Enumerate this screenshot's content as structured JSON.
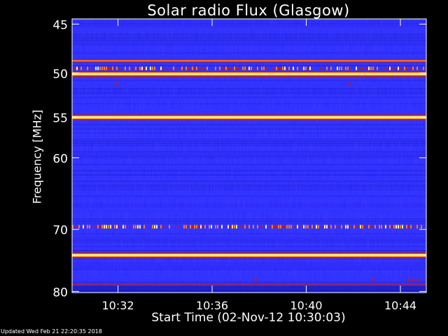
{
  "chart_data": {
    "type": "heatmap",
    "title": "Solar radio Flux (Glasgow)",
    "xlabel": "Start Time (02-Nov-12 10:30:03)",
    "ylabel": "Frequency [MHz]",
    "x_ticks": [
      "10:32",
      "10:36",
      "10:40",
      "10:44"
    ],
    "x_tick_minutes": [
      2,
      6,
      10,
      14
    ],
    "xlim_minutes": [
      0.05,
      15.1
    ],
    "y_ticks": [
      45,
      50,
      55,
      60,
      70,
      80
    ],
    "ylim": [
      44.5,
      80.2
    ],
    "colors": {
      "background_low": "#1a1ad8",
      "background_mid": "#2a2aff",
      "band_red": "#c01818",
      "band_orange": "#ff7a10",
      "band_yellow": "#fff38a"
    },
    "bands": [
      {
        "freq": 48.7,
        "intensity": "medium"
      },
      {
        "freq": 49.5,
        "intensity": "spiky"
      },
      {
        "freq": 50.1,
        "intensity": "high"
      },
      {
        "freq": 55.0,
        "intensity": "high"
      },
      {
        "freq": 69.6,
        "intensity": "spiky"
      },
      {
        "freq": 74.0,
        "intensity": "high"
      },
      {
        "freq": 78.9,
        "intensity": "low"
      }
    ]
  },
  "footer": {
    "updated": "Updated Wed Feb 21 22:20:35 2018"
  }
}
